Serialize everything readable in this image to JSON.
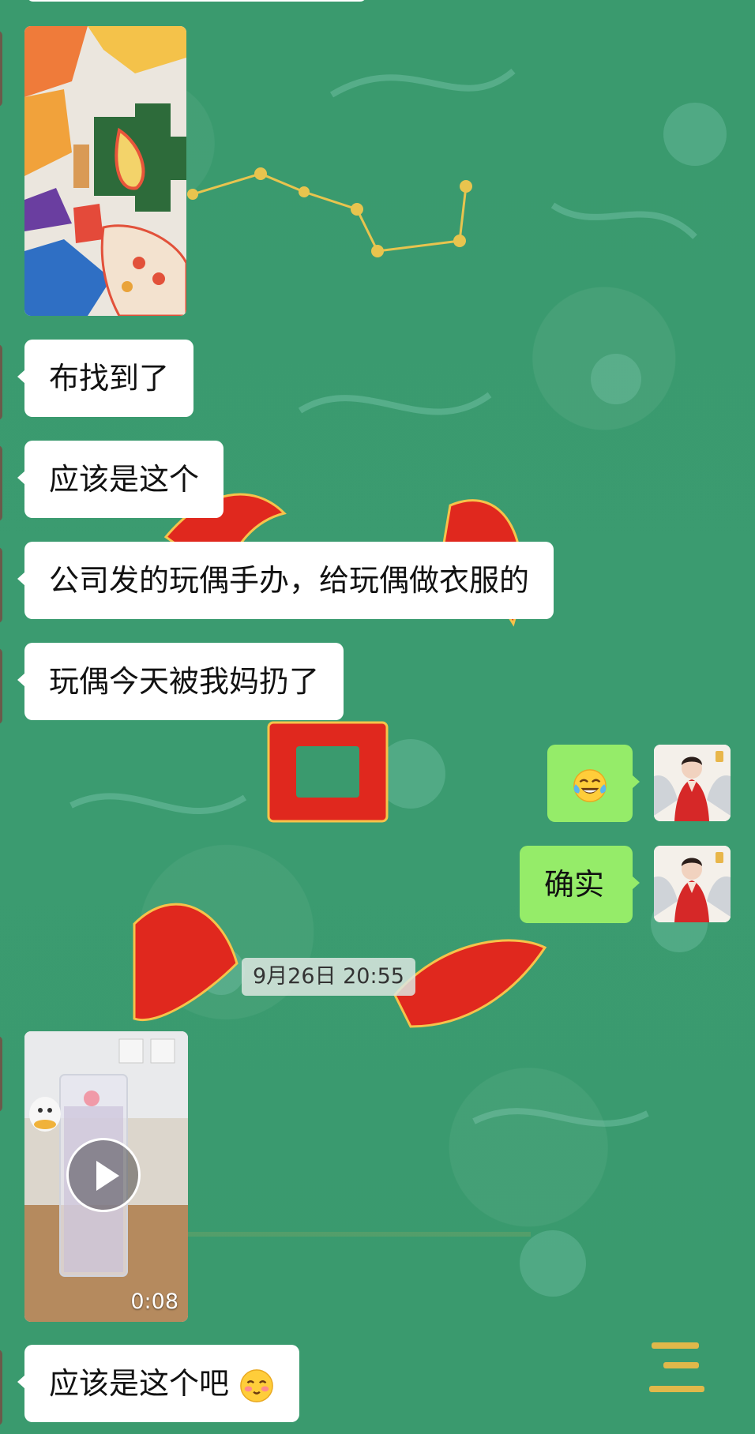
{
  "chat": {
    "messages": [
      {
        "type": "image",
        "from": "other"
      },
      {
        "type": "text",
        "from": "other",
        "text": "布找到了"
      },
      {
        "type": "text",
        "from": "other",
        "text": "应该是这个"
      },
      {
        "type": "text",
        "from": "other",
        "text": "公司发的玩偶手办，给玩偶做衣服的"
      },
      {
        "type": "text",
        "from": "other",
        "text": "玩偶今天被我妈扔了"
      },
      {
        "type": "emoji",
        "from": "me",
        "emoji_name": "crying-laughing-emoji"
      },
      {
        "type": "text",
        "from": "me",
        "text": "确实"
      },
      {
        "type": "timestamp",
        "text": "9月26日 20:55"
      },
      {
        "type": "video",
        "from": "other",
        "duration": "0:08"
      },
      {
        "type": "text",
        "from": "other",
        "text": "应该是这个吧",
        "emoji_name": "blushing-face-emoji"
      }
    ]
  },
  "colors": {
    "background": "#3a9a6e",
    "incoming_bubble": "#ffffff",
    "outgoing_bubble": "#95ec69",
    "timestamp_bg": "#dce6e1"
  }
}
